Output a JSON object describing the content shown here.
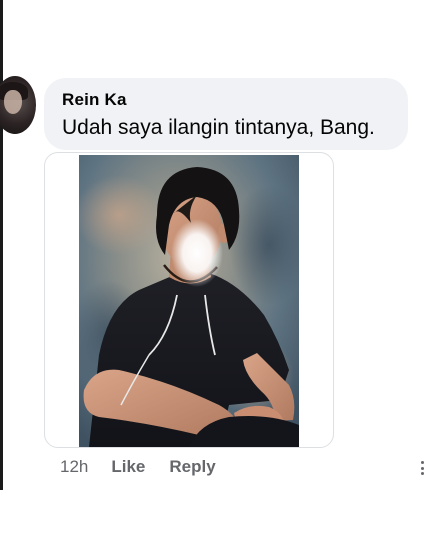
{
  "comment": {
    "author": "Rein Ka",
    "text": "Udah saya ilangin tintanya, Bang.",
    "photo_icon": "person-portrait-photo",
    "avatar_icon": "user-avatar"
  },
  "actions": {
    "timestamp": "12h",
    "like_label": "Like",
    "reply_label": "Reply",
    "more_icon": "more-options-icon"
  },
  "colors": {
    "bubble": "#f0f2f5",
    "text": "#050505",
    "secondary_text": "#65676b"
  }
}
